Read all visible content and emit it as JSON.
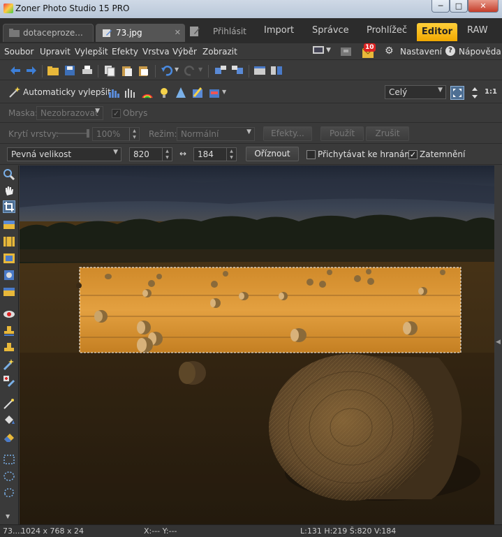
{
  "window": {
    "title": "Zoner Photo Studio 15 PRO",
    "min": "─",
    "max": "□",
    "close": "✕"
  },
  "tabs": {
    "doc1": "dotaceproze...",
    "doc2": "73.jpg",
    "close": "✕",
    "modules": {
      "login": "Přihlásit",
      "import": "Import",
      "spravce": "Správce",
      "prohlizec": "Prohlížeč",
      "editor": "Editor",
      "raw": "RAW"
    }
  },
  "menu": {
    "items": [
      "Soubor",
      "Upravit",
      "Vylepšit",
      "Efekty",
      "Vrstva",
      "Výběr",
      "Zobrazit"
    ],
    "notifications": "10",
    "settings": "Nastavení",
    "help": "Nápověda"
  },
  "toolbar2": {
    "auto_improve": "Automaticky vylepšit",
    "zoom_select": "Celý",
    "fit_icon": "1:1"
  },
  "mask_bar": {
    "label": "Maska:",
    "value": "Nezobrazovat",
    "outline": "Obrys",
    "outline_check": "✓"
  },
  "layer_bar": {
    "opacity_label": "Krytí vrstvy:",
    "opacity_value": "100%",
    "mode_label": "Režim:",
    "mode_value": "Normální",
    "effects": "Efekty...",
    "apply": "Použít",
    "cancel": "Zrušit"
  },
  "crop_bar": {
    "size_mode": "Pevná velikost",
    "width": "820",
    "swap": "↔",
    "height": "184",
    "crop_button": "Oříznout",
    "snap_label": "Přichytávat ke hranám",
    "darken_label": "Zatemnění",
    "darken_check": "✓"
  },
  "status": {
    "file": "73....",
    "dims": "1024 x 768 x 24",
    "cursor": "X:---  Y:---",
    "selection": "L:131  H:219  Š:820  V:184"
  },
  "colors": {
    "accent": "#f5b800",
    "chrome": "#3a3a3a",
    "selection": "#4e6f93"
  }
}
